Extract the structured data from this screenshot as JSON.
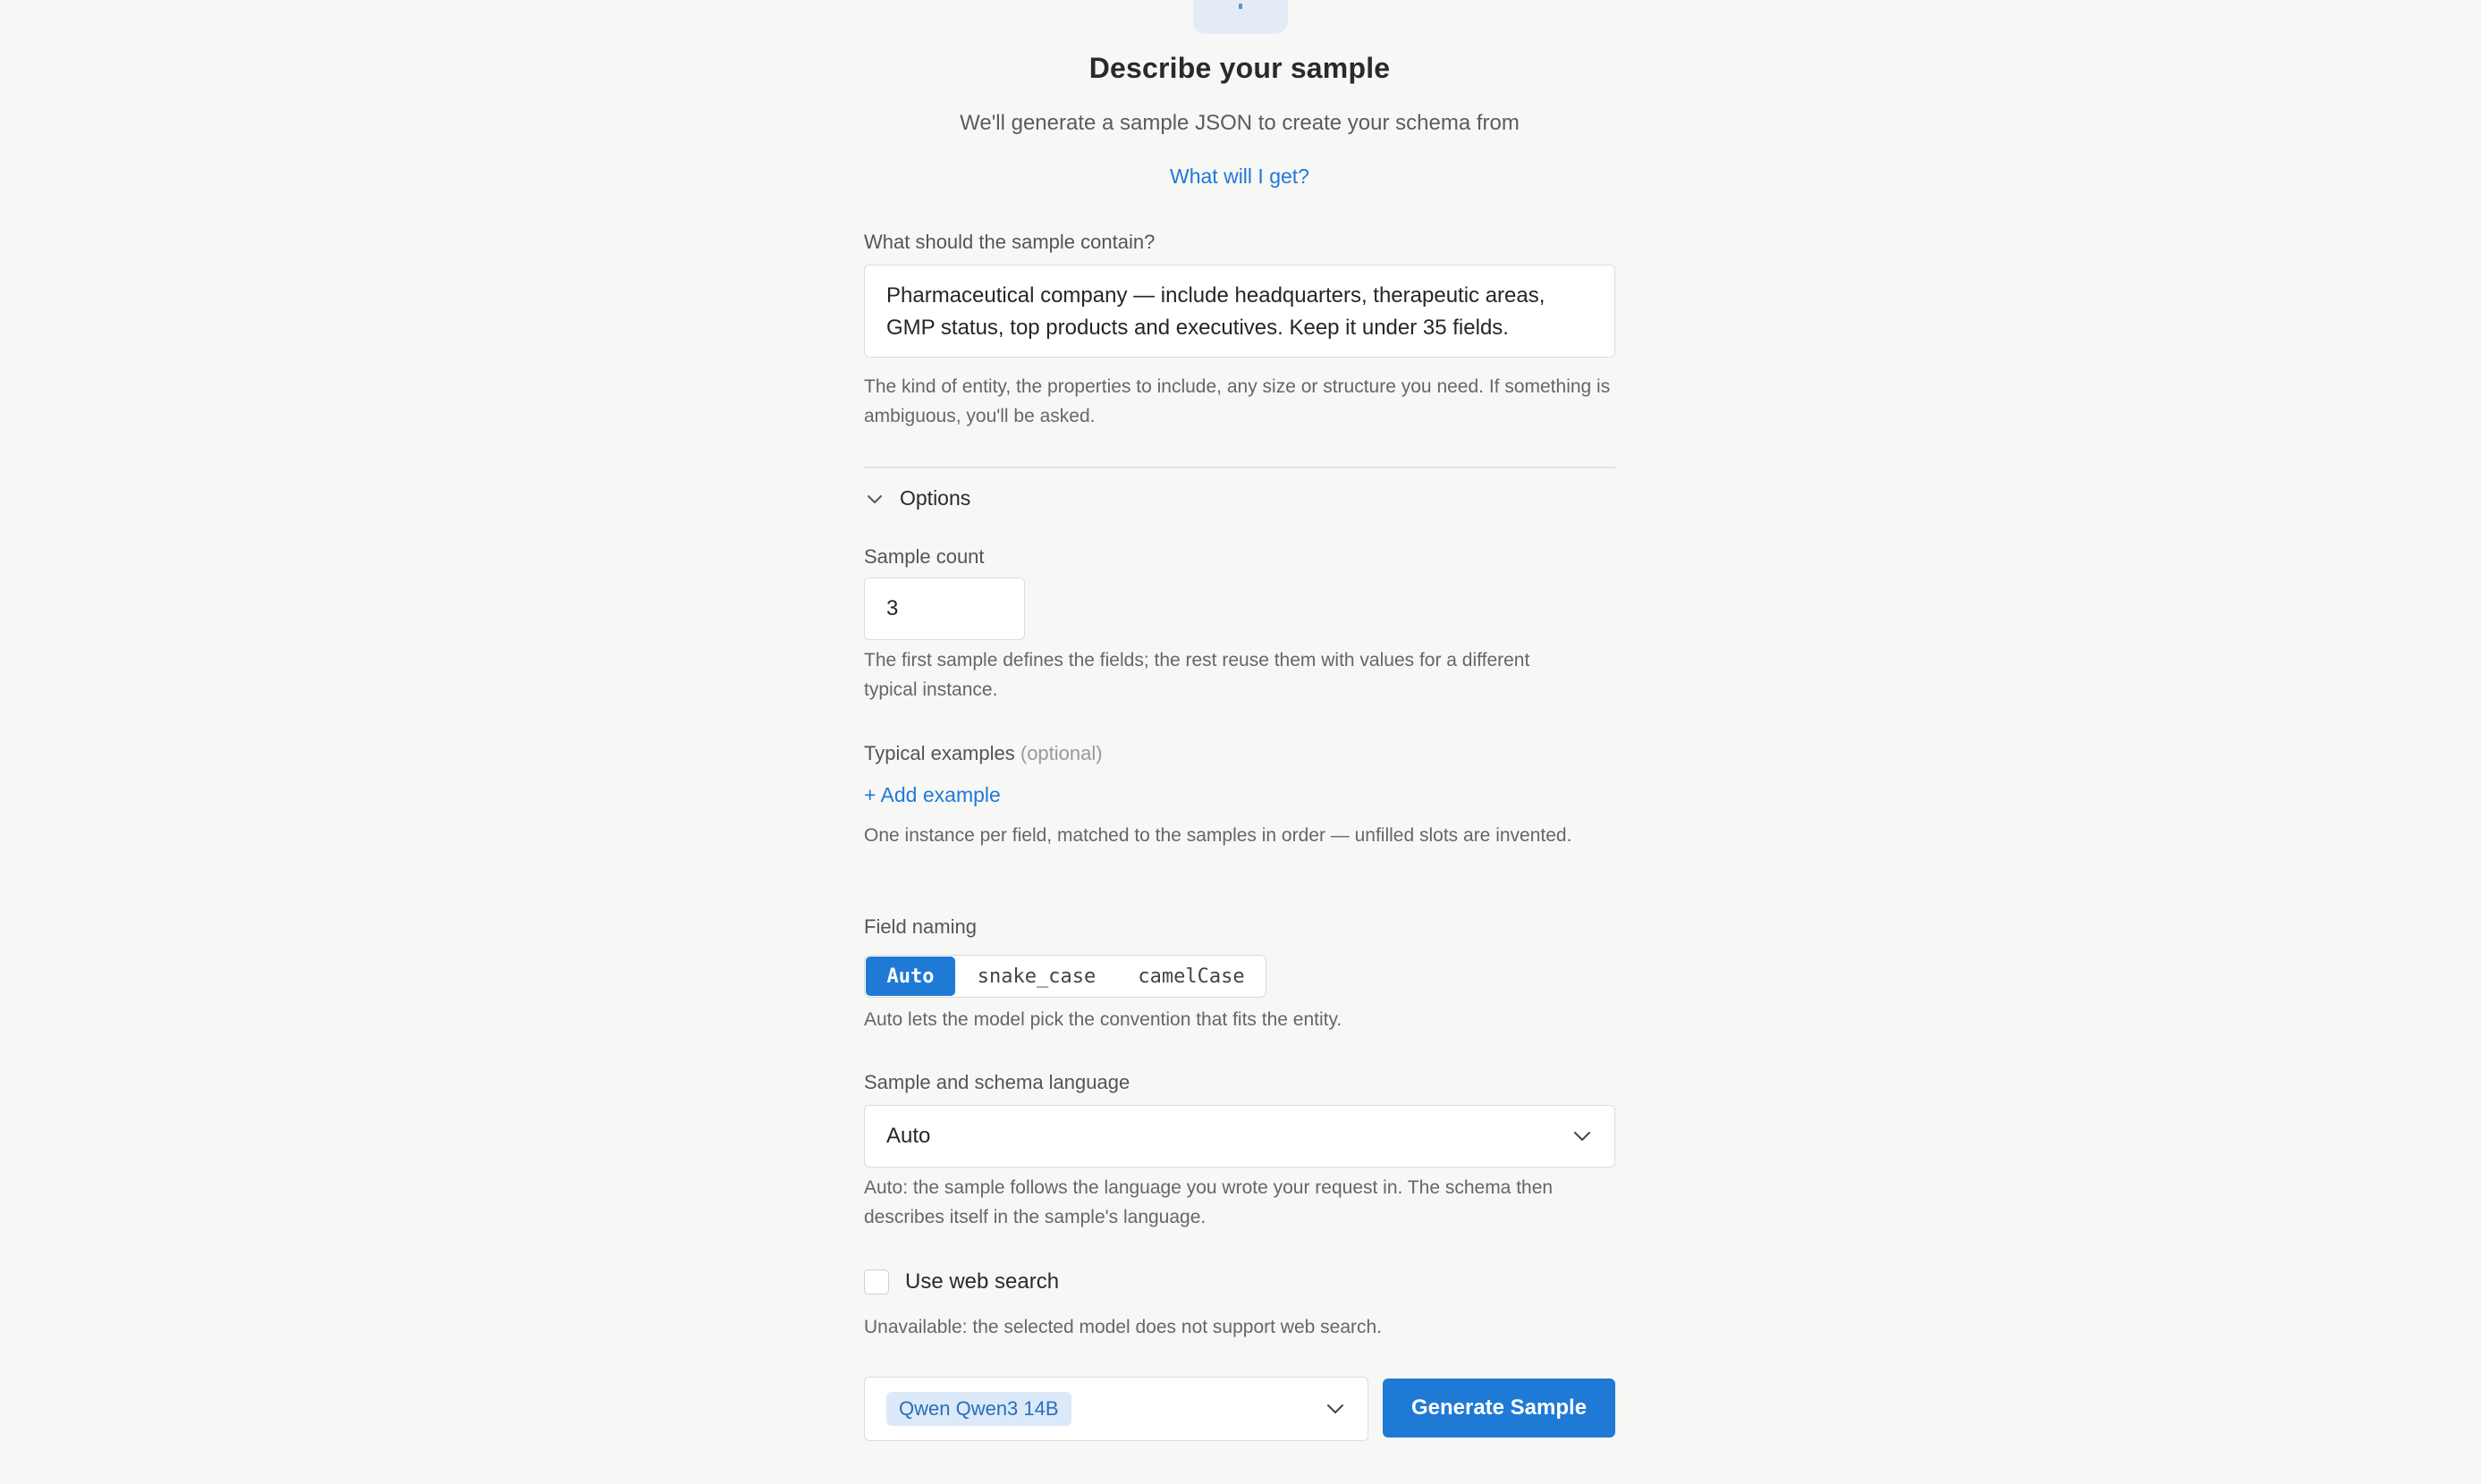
{
  "header": {
    "title": "Describe your sample",
    "subtitle": "We'll generate a sample JSON to create your schema from",
    "help_link": "What will I get?"
  },
  "description": {
    "label": "What should the sample contain?",
    "value": "Pharmaceutical company — include headquarters, therapeutic areas, GMP status, top products and executives. Keep it under 35 fields.",
    "hint": "The kind of entity, the properties to include, any size or structure you need. If something is ambiguous, you'll be asked."
  },
  "options": {
    "toggle_label": "Options",
    "expanded": true,
    "sample_count": {
      "label": "Sample count",
      "value": "3",
      "hint": "The first sample defines the fields; the rest reuse them with values for a different typical instance."
    },
    "typical_examples": {
      "label": "Typical examples",
      "optional": "(optional)",
      "add_label": "+ Add example",
      "hint": "One instance per field, matched to the samples in order — unfilled slots are invented."
    },
    "field_naming": {
      "label": "Field naming",
      "choices": [
        "Auto",
        "snake_case",
        "camelCase"
      ],
      "selected": "Auto",
      "hint": "Auto lets the model pick the convention that fits the entity."
    },
    "language": {
      "label": "Sample and schema language",
      "value": "Auto",
      "hint": "Auto: the sample follows the language you wrote your request in. The schema then describes itself in the sample's language."
    },
    "web_search": {
      "label": "Use web search",
      "checked": false,
      "hint": "Unavailable: the selected model does not support web search."
    }
  },
  "footer": {
    "model": "Qwen Qwen3 14B",
    "generate_label": "Generate Sample"
  },
  "colors": {
    "accent": "#1f7ad6",
    "background": "#f7f7f5",
    "chip_bg": "#dbe9f8"
  },
  "icons": {
    "options_toggle": "chevron-down-icon",
    "language_select": "chevron-down-icon",
    "model_select": "chevron-down-icon"
  }
}
